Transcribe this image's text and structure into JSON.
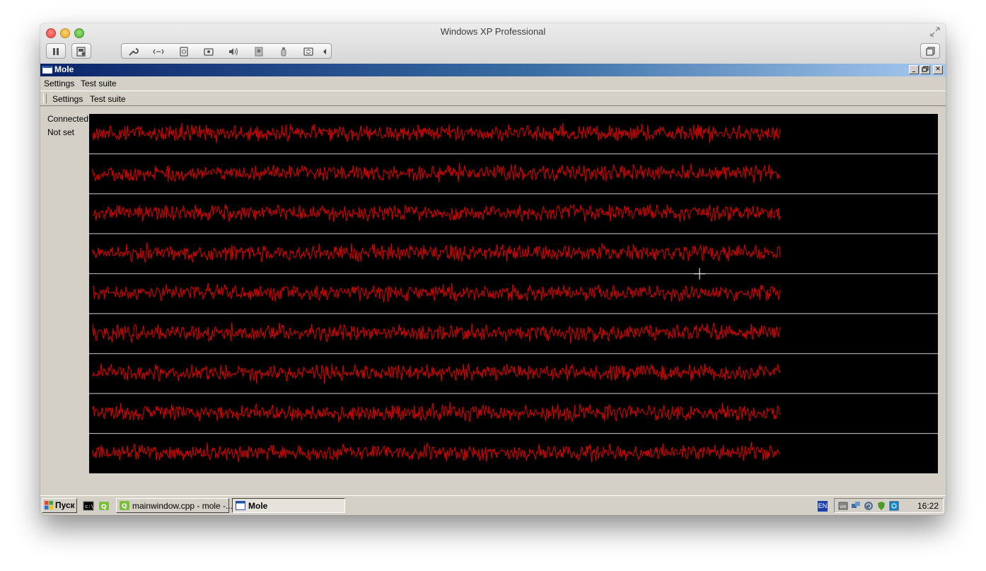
{
  "host": {
    "title": "Windows XP Professional",
    "toolbar_icons": [
      "pause-icon",
      "snapshot-icon",
      "settings-wrench-icon",
      "network-icon",
      "hard-disk-icon",
      "cd-dvd-icon",
      "sound-icon",
      "camera-icon",
      "usb-icon",
      "shared-folders-icon",
      "collapse-arrow-icon",
      "unity-view-icon"
    ]
  },
  "app": {
    "title": "Mole",
    "menu": [
      "Settings",
      "Test suite"
    ],
    "toolbar": [
      "Settings",
      "Test suite"
    ],
    "status": {
      "connection": "Connected",
      "mode": "Not set"
    },
    "signal_color": "#e00000",
    "plot_background": "#000000",
    "channel_count": 9
  },
  "taskbar": {
    "start_label": "Пуск",
    "quick_launch_icons": [
      "console-icon",
      "qt-creator-icon"
    ],
    "tasks": [
      {
        "label": "mainwindow.cpp - mole -...",
        "icon": "qt-creator-icon",
        "active": false
      },
      {
        "label": "Mole",
        "icon": "window-icon",
        "active": true
      }
    ],
    "tray": {
      "language": "EN",
      "icons": [
        "vmware-tools-icon",
        "network-tray-icon",
        "update-icon",
        "shield-icon",
        "monitor-tray-icon"
      ],
      "clock": "16:22"
    }
  }
}
